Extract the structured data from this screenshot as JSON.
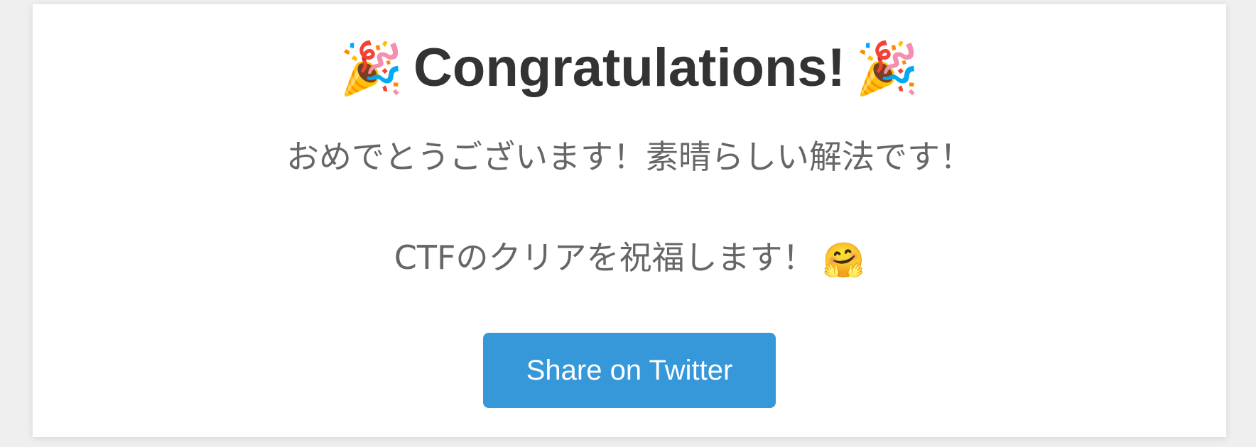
{
  "header": {
    "title": "Congratulations!",
    "left_icon": "party-popper-icon",
    "right_icon": "party-popper-icon",
    "left_emoji": "🎉",
    "right_emoji": "🎉"
  },
  "messages": {
    "line1": "おめでとうございます！素晴らしい解法です！",
    "line2": "CTFのクリアを祝福します！",
    "line2_icon": "hugging-face-icon",
    "line2_emoji": "🤗"
  },
  "actions": {
    "share_label": "Share on Twitter"
  },
  "colors": {
    "background": "#efefef",
    "card": "#ffffff",
    "title": "#333333",
    "text": "#666666",
    "button": "#3798d9",
    "button_text": "#ffffff"
  }
}
